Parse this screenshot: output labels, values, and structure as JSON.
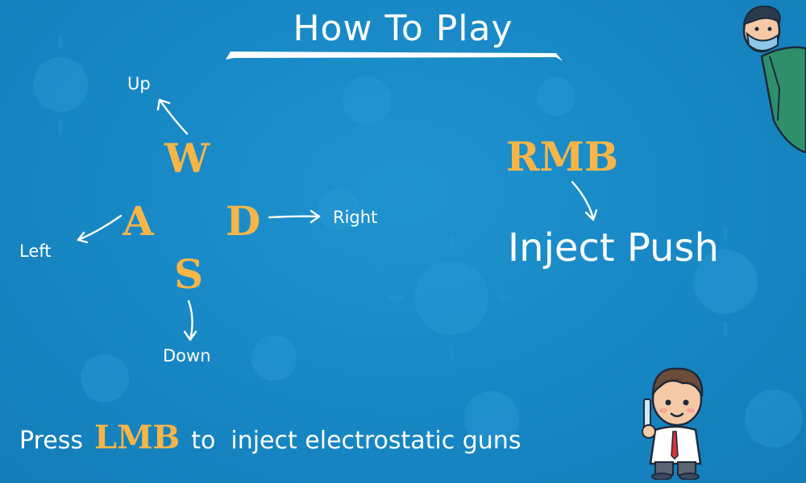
{
  "title": "How To Play",
  "movement": {
    "keys": {
      "up": "W",
      "left": "A",
      "right": "D",
      "down": "S"
    },
    "labels": {
      "up": "Up",
      "left": "Left",
      "right": "Right",
      "down": "Down"
    }
  },
  "action": {
    "key": "RMB",
    "label": "Inject Push"
  },
  "instruction": {
    "prefix": "Press",
    "key": "LMB",
    "suffix": "to  inject electrostatic guns"
  },
  "colors": {
    "background": "#1787c4",
    "key_highlight": "#f7b548",
    "text": "#ffffff"
  }
}
